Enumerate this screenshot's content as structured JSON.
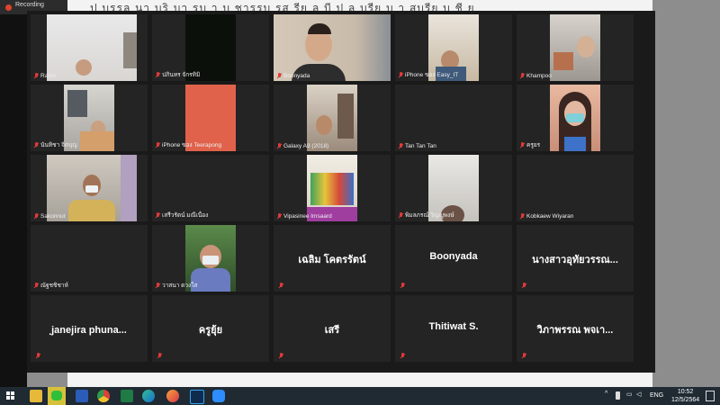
{
  "recording": {
    "label": "Recording"
  },
  "document_text": "ป บรรลุ นา บริ บา รบ า บ ชารรบ รส รีย   ลุ  บี ป ล บรีย บ  า สบรีย บ  ชี ย",
  "participants": [
    {
      "name": "Rabin",
      "muted": true,
      "video": "room1"
    },
    {
      "name": "ปภินทร จักรทิมิ",
      "muted": true,
      "video": "dark"
    },
    {
      "name": "Boonyada",
      "muted": true,
      "video": "room2"
    },
    {
      "name": "iPhone ของ Easy_IT",
      "muted": true,
      "video": "room3"
    },
    {
      "name": "Khampoo",
      "muted": true,
      "video": "room4"
    },
    {
      "name": "นันทิชา จิตบุญ",
      "muted": true,
      "video": "room5"
    },
    {
      "name": "iPhone ของ Teerapong",
      "muted": true,
      "video": "red"
    },
    {
      "name": "Galaxy A9 (2018)",
      "muted": true,
      "video": "room6"
    },
    {
      "name": "Tan Tan Tan",
      "muted": true,
      "video": "none"
    },
    {
      "name": "ครูยร",
      "muted": true,
      "video": "room7"
    },
    {
      "name": "Sakonnut",
      "muted": true,
      "video": "room8"
    },
    {
      "name": "เสรีวรัตน์ มณีเนื่อง",
      "muted": true,
      "video": "none"
    },
    {
      "name": "Vipasinee Imsaard",
      "muted": true,
      "video": "room9"
    },
    {
      "name": "พิมลภรณ์ วิญญูพงษ์",
      "muted": true,
      "video": "room10"
    },
    {
      "name": "Kobkaew Wiyaran",
      "muted": true,
      "video": "none"
    },
    {
      "name": "ณัฐชชิชาห์",
      "muted": true,
      "video": "none"
    },
    {
      "name": "วาสนา ดวงใส",
      "muted": true,
      "video": "room11"
    },
    {
      "name": "เฉลิม  โคตรรัตน์",
      "muted": true,
      "video": "name"
    },
    {
      "name": "Boonyada",
      "muted": true,
      "video": "name"
    },
    {
      "name": "นางสาวอุทัยวรรณ...",
      "muted": true,
      "video": "name"
    },
    {
      "name": "ฺjanejira  phuna...",
      "muted": true,
      "video": "name"
    },
    {
      "name": "ครูยุ้ย",
      "muted": true,
      "video": "name"
    },
    {
      "name": "เสรี",
      "muted": true,
      "video": "name"
    },
    {
      "name": "Thitiwat S.",
      "muted": true,
      "video": "name"
    },
    {
      "name": "วิภาพรรณ  พจเา...",
      "muted": true,
      "video": "name"
    }
  ],
  "taskbar": {
    "apps": [
      "file-explorer-icon",
      "line-icon",
      "word-icon",
      "chrome-icon",
      "excel-icon",
      "edge-icon",
      "firefox-icon",
      "photoshop-icon",
      "zoom-icon"
    ],
    "language": "ENG",
    "time": "10:52",
    "date": "12/5/2564"
  }
}
